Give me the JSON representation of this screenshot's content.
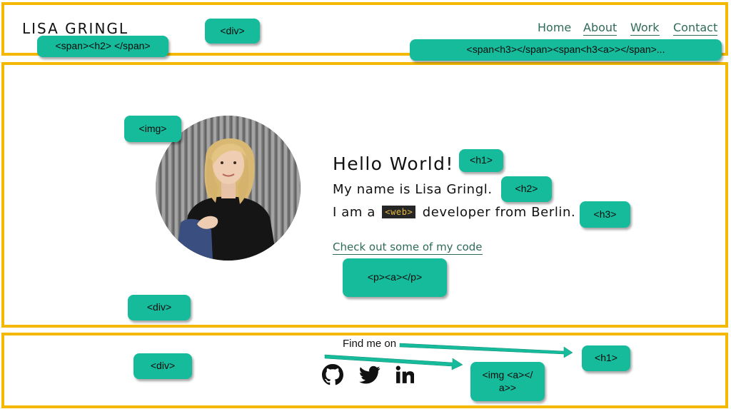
{
  "header": {
    "brand": "LISA GRINGL",
    "nav": [
      {
        "label": "Home"
      },
      {
        "label": "About"
      },
      {
        "label": "Work"
      },
      {
        "label": "Contact"
      }
    ]
  },
  "hero": {
    "hello": "Hello World!",
    "name_line": "My name is Lisa Gringl.",
    "iam_prefix": "I am a",
    "web_chip": "<web>",
    "iam_suffix": "developer from Berlin.",
    "code_link": "Check out some of my code"
  },
  "footer": {
    "find_me": "Find me on",
    "social": [
      "github-icon",
      "twitter-icon",
      "linkedin-icon"
    ]
  },
  "annotations": {
    "header_span_h2": "<span><h2> </span>",
    "header_div": "<div>",
    "header_nav_spans": "<span<h3></span><span<h3<a>></span>...",
    "img": "<img>",
    "h1": "<h1>",
    "h2": "<h2>",
    "h3": "<h3>",
    "p_a": "<p><a></p>",
    "hero_div": "<div>",
    "footer_div": "<div>",
    "footer_h1": "<h1>",
    "img_a_line1": "<img <a></",
    "img_a_line2": "a>>"
  },
  "colors": {
    "frame": "#f5b800",
    "tag": "#16bb9c",
    "link": "#2f6b5a",
    "chip_bg": "#262626",
    "chip_text": "#e2b93b"
  }
}
